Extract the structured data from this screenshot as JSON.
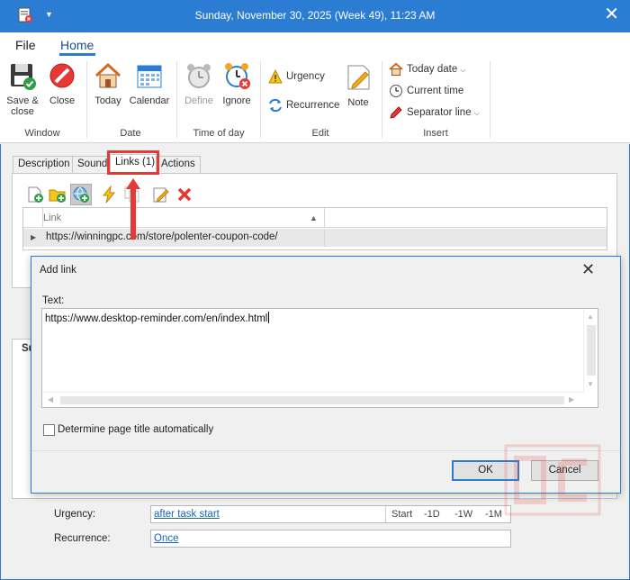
{
  "window": {
    "title": "Sunday, November 30, 2025 (Week 49), 11:23 AM"
  },
  "ribbon_tabs": [
    "File",
    "Home"
  ],
  "ribbon": {
    "groups": {
      "window": "Window",
      "date": "Date",
      "time_of_day": "Time of day",
      "edit": "Edit",
      "insert": "Insert"
    },
    "save_close_line1": "Save &",
    "save_close_line2": "close",
    "close": "Close",
    "today": "Today",
    "calendar": "Calendar",
    "define": "Define",
    "ignore": "Ignore",
    "urgency": "Urgency",
    "recurrence": "Recurrence",
    "note": "Note",
    "today_date": "Today date",
    "current_time": "Current time",
    "separator_line": "Separator line"
  },
  "tabs": [
    "Description",
    "Sound",
    "Links (1)",
    "Actions"
  ],
  "links_grid": {
    "column": "Link",
    "rows": [
      "https://winningpc.com/store/polenter-coupon-code/"
    ]
  },
  "background_section_label": "Su",
  "bottom": {
    "urgency_label": "Urgency:",
    "urgency_value": "after task start",
    "start_segments": [
      "Start",
      "-1D",
      "-1W",
      "-1M"
    ],
    "recurrence_label": "Recurrence:",
    "recurrence_value": "Once"
  },
  "dialog": {
    "title": "Add link",
    "text_label": "Text:",
    "text_value": "https://www.desktop-reminder.com/en/index.html",
    "checkbox_label": "Determine page title automatically",
    "ok": "OK",
    "cancel": "Cancel"
  },
  "colors": {
    "title_bar": "#2b7cd3",
    "highlight": "#e53935",
    "link": "#1565c0"
  }
}
